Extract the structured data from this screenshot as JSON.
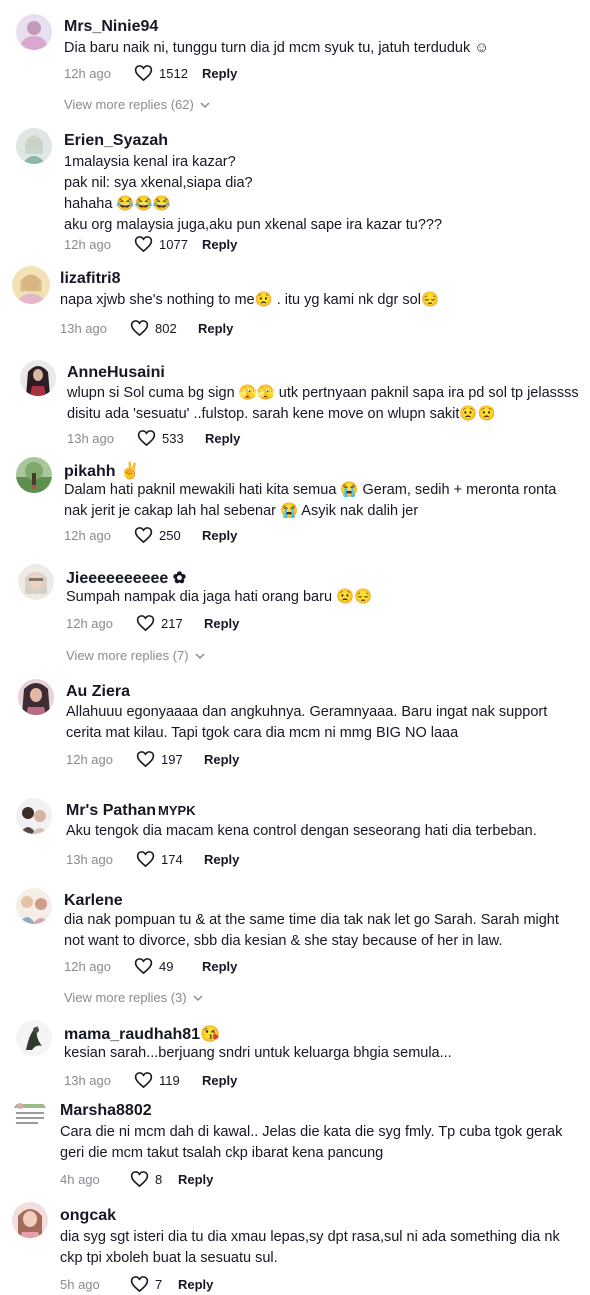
{
  "reply_label": "Reply",
  "comments": [
    {
      "user": "Mrs_Ninie94",
      "text": [
        "Dia baru naik ni, tunggu turn dia jd mcm syuk tu, jatuh terduduk ☺"
      ],
      "time": "12h ago",
      "likes": "1512",
      "view_more": "View more replies (62)"
    },
    {
      "user": "Erien_Syazah",
      "text": [
        "1malaysia kenal ira kazar?",
        "pak nil: sya xkenal,siapa dia?",
        "hahaha 😂😂😂",
        "aku org malaysia juga,aku pun xkenal sape ira kazar tu???"
      ],
      "time": "12h ago",
      "likes": "1077"
    },
    {
      "user": "lizafitri8",
      "text": [
        "napa xjwb she's nothing to me😟 . itu yg kami nk dgr sol😔"
      ],
      "time": "13h ago",
      "likes": "802"
    },
    {
      "user": "AnneHusaini",
      "text": [
        "wlupn si Sol cuma bg sign 🫣🫣 utk pertnyaan paknil sapa ira pd sol tp jelassss",
        "disitu ada 'sesuatu' ..fulstop. sarah kene move on wlupn sakit😟😟"
      ],
      "time": "13h ago",
      "likes": "533"
    },
    {
      "user": "pikahh ✌️",
      "text": [
        "Dalam hati paknil mewakili hati kita semua 😭 Geram, sedih + meronta ronta",
        "nak jerit je cakap lah hal sebenar 😭 Asyik nak dalih jer"
      ],
      "time": "12h ago",
      "likes": "250"
    },
    {
      "user": "Jieeeeeeeeee ✿",
      "text": [
        "Sumpah nampak dia jaga hati orang baru 😟😔"
      ],
      "time": "12h ago",
      "likes": "217",
      "view_more": "View more replies (7)"
    },
    {
      "user": "Au Ziera",
      "text": [
        "Allahuuu egonyaaaa dan angkuhnya. Geramnyaaa. Baru ingat nak support",
        "cerita mat kilau. Tapi tgok cara dia mcm ni mmg BIG NO laaa"
      ],
      "time": "12h ago",
      "likes": "197"
    },
    {
      "user": "Mr's Pathan",
      "user_suffix": "MYPK",
      "text": [
        "Aku tengok dia macam kena control dengan seseorang hati dia terbeban."
      ],
      "time": "13h ago",
      "likes": "174"
    },
    {
      "user": "Karlene",
      "text": [
        "dia nak pompuan tu & at the same time dia tak nak let go Sarah. Sarah might",
        "not want to divorce, sbb dia kesian & she stay because of her in law."
      ],
      "time": "12h ago",
      "likes": "49",
      "view_more": "View more replies (3)"
    },
    {
      "user": "mama_raudhah81😘",
      "text": [
        "kesian sarah...berjuang sndri untuk keluarga bhgia semula..."
      ],
      "time": "13h ago",
      "likes": "119"
    },
    {
      "user": "Marsha8802",
      "text": [
        "Cara die ni mcm dah di kawal.. Jelas die kata die syg fmly. Tp cuba tgok gerak",
        "geri die mcm takut tsalah ckp ibarat kena pancung"
      ],
      "time": "4h ago",
      "likes": "8"
    },
    {
      "user": "ongcak",
      "text": [
        "dia syg sgt isteri dia tu dia xmau lepas,sy dpt rasa,sul ni ada something dia nk",
        "ckp tpi xboleh buat la sesuatu sul."
      ],
      "time": "5h ago",
      "likes": "7"
    }
  ]
}
